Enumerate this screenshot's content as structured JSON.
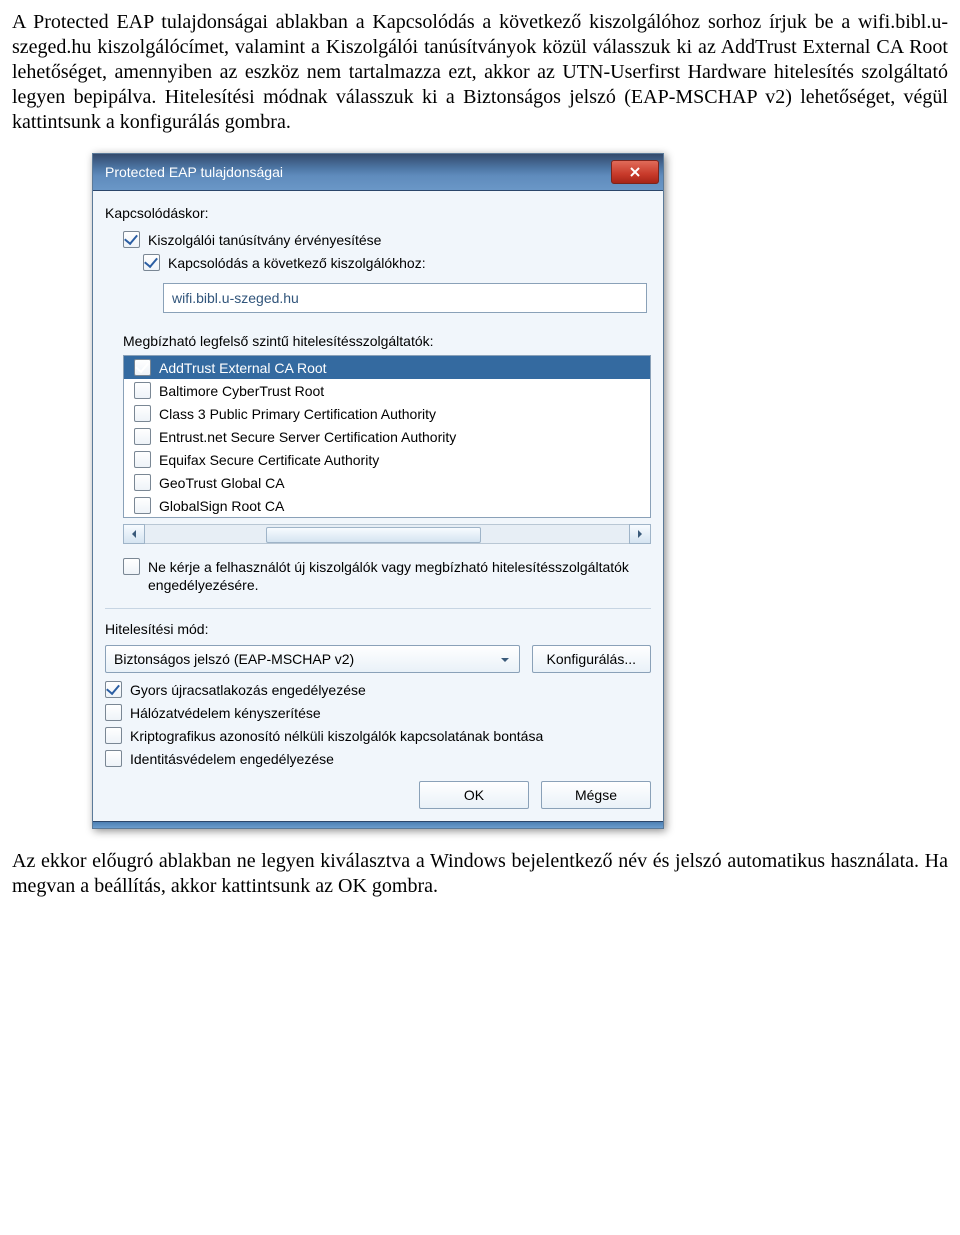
{
  "intro_para": "A Protected EAP tulajdonságai ablakban a Kapcsolódás a következő kiszolgálóhoz sorhoz írjuk be a wifi.bibl.u-szeged.hu kiszolgálócímet, valamint a Kiszolgálói tanúsítványok közül válasszuk ki az AddTrust External CA Root lehetőséget, amennyiben az eszköz nem tartalmazza ezt, akkor az UTN-Userfirst Hardware hitelesítés szolgáltató legyen bepipálva. Hitelesítési módnak válasszuk ki a Biztonságos jelszó (EAP-MSCHAP v2) lehetőséget, végül kattintsunk a konfigurálás gombra.",
  "outro_para": "Az ekkor előugró ablakban ne legyen kiválasztva a Windows bejelentkező név és jelszó automatikus használata. Ha megvan a beállítás, akkor kattintsunk az OK gombra.",
  "dialog": {
    "title": "Protected EAP tulajdonságai",
    "close_icon": "close",
    "section_connect": "Kapcsolódáskor:",
    "chk_validate": "Kiszolgálói tanúsítvány érvényesítése",
    "chk_connect_to": "Kapcsolódás a következő kiszolgálókhoz:",
    "server_value": "wifi.bibl.u-szeged.hu",
    "trusted_header": "Megbízható legfelső szintű hitelesítésszolgáltatók:",
    "ca_list": [
      {
        "label": "AddTrust External CA Root",
        "checked": true,
        "selected": true
      },
      {
        "label": "Baltimore CyberTrust Root",
        "checked": false,
        "selected": false
      },
      {
        "label": "Class 3 Public Primary Certification Authority",
        "checked": false,
        "selected": false
      },
      {
        "label": "Entrust.net Secure Server Certification Authority",
        "checked": false,
        "selected": false
      },
      {
        "label": "Equifax Secure Certificate Authority",
        "checked": false,
        "selected": false
      },
      {
        "label": "GeoTrust Global CA",
        "checked": false,
        "selected": false
      },
      {
        "label": "GlobalSign Root CA",
        "checked": false,
        "selected": false
      }
    ],
    "ne_kerje": "Ne kérje a felhasználót új kiszolgálók vagy megbízható hitelesítésszolgáltatók engedélyezésére.",
    "auth_mode_label": "Hitelesítési mód:",
    "auth_mode_value": "Biztonságos jelszó (EAP-MSCHAP v2)",
    "config_btn": "Konfigurálás...",
    "chk_fast_reconnect": "Gyors újracsatlakozás engedélyezése",
    "chk_network_protection": "Hálózatvédelem kényszerítése",
    "chk_crypto_bind": "Kriptografikus azonosító nélküli kiszolgálók kapcsolatának bontása",
    "chk_identity_protection": "Identitásvédelem engedélyezése",
    "ok_btn": "OK",
    "cancel_btn": "Mégse"
  }
}
